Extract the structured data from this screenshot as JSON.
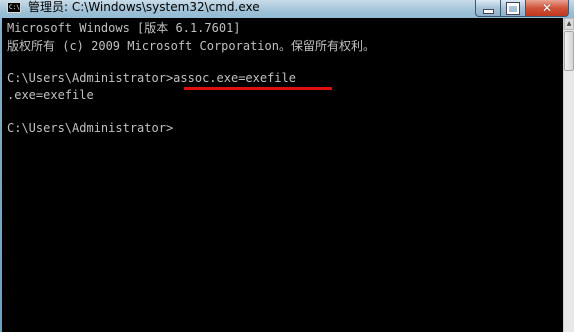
{
  "window": {
    "title": "管理员: C:\\Windows\\system32\\cmd.exe",
    "app_icon_text": "C:\\",
    "minimize_label": "",
    "maximize_label": "",
    "close_label": "✕"
  },
  "console": {
    "lines": [
      "Microsoft Windows [版本 6.1.7601]",
      "版权所有 (c) 2009 Microsoft Corporation。保留所有权利。",
      "",
      "C:\\Users\\Administrator>assoc.exe=exefile",
      ".exe=exefile",
      "",
      "C:\\Users\\Administrator>"
    ]
  },
  "colors": {
    "console_background": "#000000",
    "console_text": "#c0c0c0",
    "highlight_underline": "#e01010",
    "close_button": "#c8452a"
  }
}
